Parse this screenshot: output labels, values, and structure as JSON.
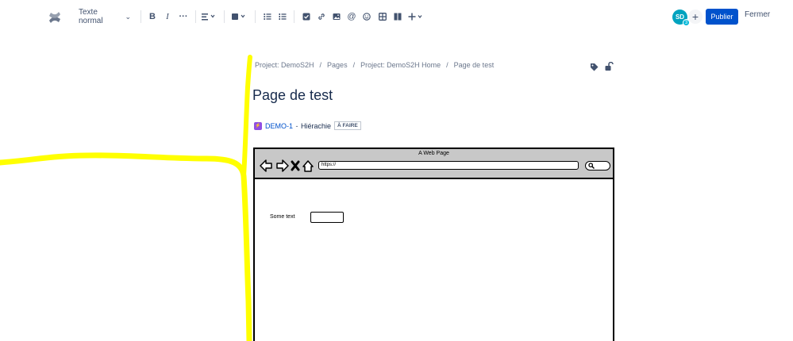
{
  "toolbar": {
    "text_style": "Texte normal",
    "tools": [
      "bold-icon",
      "italic-icon",
      "more-icon",
      "align-icon",
      "color-icon",
      "bullet-list-icon",
      "numbered-list-icon",
      "task-icon",
      "link-icon",
      "image-icon",
      "mention-icon",
      "emoji-icon",
      "table-icon",
      "layout-icon",
      "insert-icon"
    ],
    "avatar_initials": "SD",
    "avatar_count": "3",
    "publish_label": "Publier",
    "close_label": "Fermer"
  },
  "breadcrumb": {
    "items": [
      "Project: DemoS2H",
      "Pages",
      "Project: DemoS2H Home",
      "Page de test"
    ]
  },
  "page": {
    "title": "Page de test"
  },
  "issue": {
    "key": "DEMO-1",
    "separator": " - ",
    "summary": "Hiérachie",
    "status": "À FAIRE"
  },
  "mockup": {
    "title": "A Web Page",
    "url": "https://",
    "text": "Some text"
  },
  "colors": {
    "accent": "#0052cc",
    "avatar": "#00a3bf",
    "highlight": "#ffff00",
    "issue_type": "#904ee2"
  }
}
